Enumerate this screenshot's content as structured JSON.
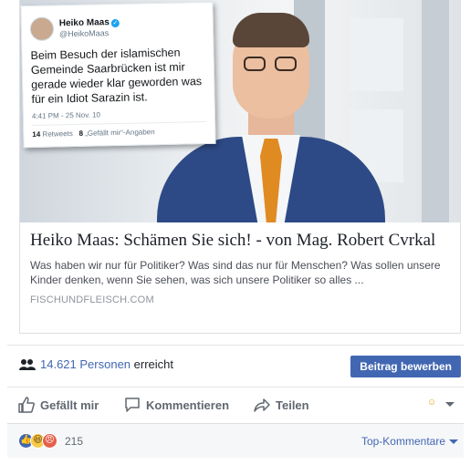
{
  "tweet": {
    "name": "Heiko Maas",
    "handle": "@HeikoMaas",
    "text": "Beim Besuch der islamischen Gemeinde Saarbrücken ist mir gerade wieder klar geworden was für ein Idiot Sarazin ist.",
    "time": "4:41 PM - 25 Nov. 10",
    "retweets_count": "14",
    "retweets_label": "Retweets",
    "likes_count": "8",
    "likes_label": "„Gefällt mir“-Angaben"
  },
  "link": {
    "title": "Heiko Maas: Schämen Sie sich! - von Mag. Robert Cvrkal",
    "description": "Was haben wir nur für Politiker? Was sind das nur für Menschen? Was sollen unsere Kinder denken, wenn Sie sehen, was sich unsere Politiker so alles ...",
    "domain": "FISCHUNDFLEISCH.COM"
  },
  "reach": {
    "count_link": "14.621 Personen",
    "suffix": "erreicht",
    "promote_button": "Beitrag bewerben"
  },
  "actions": {
    "like": "Gefällt mir",
    "comment": "Kommentieren",
    "share": "Teilen"
  },
  "reactions": {
    "count": "215",
    "sort_label": "Top-Kommentare"
  },
  "colors": {
    "accent": "#4267b2",
    "text_muted": "#606770"
  }
}
